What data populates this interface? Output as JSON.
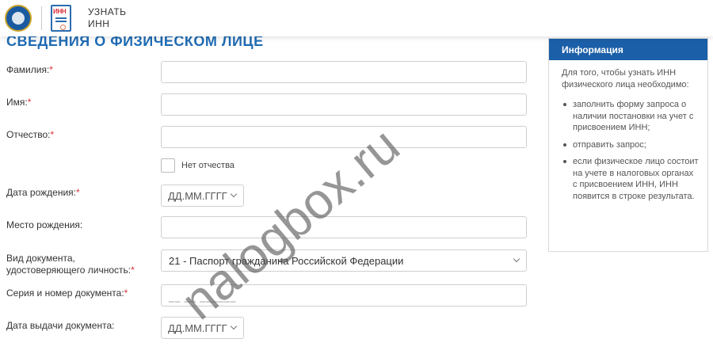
{
  "header": {
    "emblem_icon": "fns-emblem-icon",
    "inn_icon_text": "ИНН",
    "brand_line1": "УЗНАТЬ",
    "brand_line2": "ИНН"
  },
  "page_title": "СВЕДЕНИЯ О ФИЗИЧЕСКОМ ЛИЦЕ",
  "required_mark": "*",
  "form": {
    "surname_label": "Фамилия:",
    "name_label": "Имя:",
    "patronymic_label": "Отчество:",
    "no_patronymic_label": "Нет отчества",
    "birth_date_label": "Дата рождения:",
    "birth_date_placeholder": "ДД.ММ.ГГГГ",
    "birth_place_label": "Место рождения:",
    "doc_type_label_line1": "Вид документа,",
    "doc_type_label_line2": "удостоверяющего личность:",
    "doc_type_value": "21 - Паспорт гражданина Российской Федерации",
    "doc_number_label": "Серия и номер документа:",
    "doc_number_mask": "__ __ ______",
    "issue_date_label": "Дата выдачи документа:",
    "issue_date_placeholder": "ДД.ММ.ГГГГ"
  },
  "info": {
    "title": "Информация",
    "intro": "Для того, чтобы узнать ИНН физического лица необходимо:",
    "items": [
      "заполнить форму запроса о наличии постановки на учет с присвоением ИНН;",
      "отправить запрос;",
      "если физическое лицо состоит на учете в налоговых органах с присвоением ИНН, ИНН появится в строке результата."
    ]
  },
  "watermark": "nalogbox.ru",
  "colors": {
    "accent": "#1f6bb3",
    "info_header": "#1b5fa8",
    "required": "#d9303a"
  }
}
